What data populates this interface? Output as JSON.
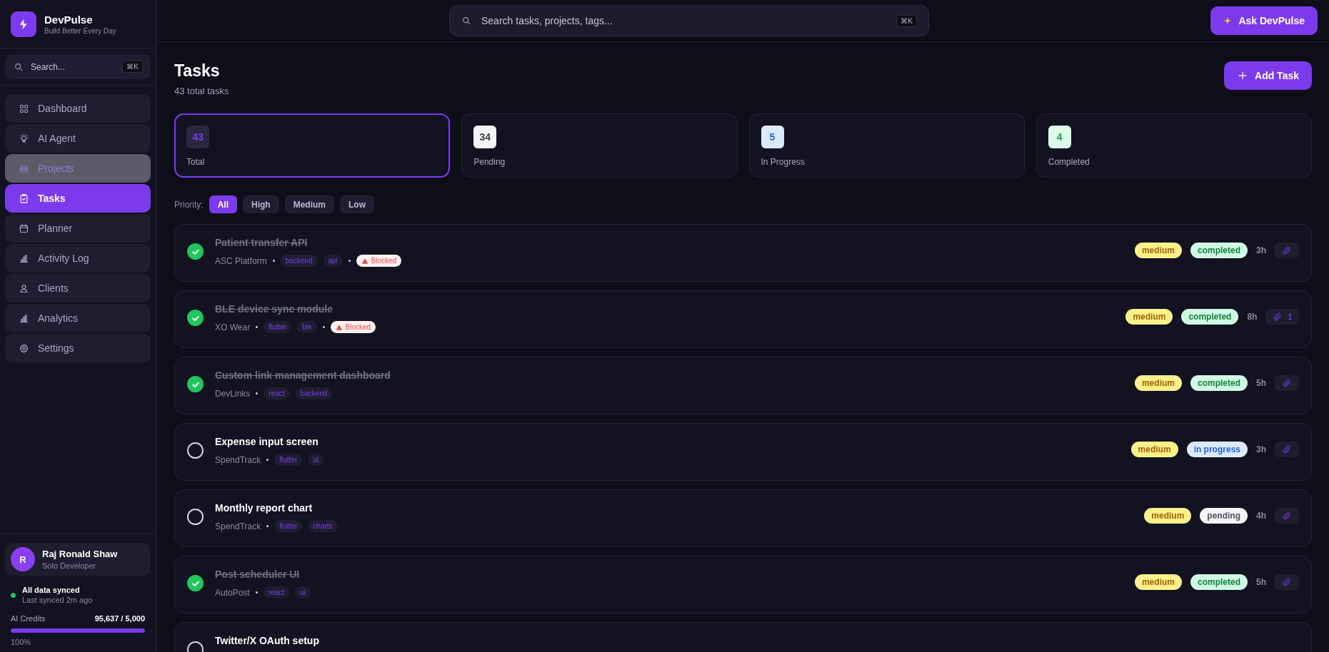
{
  "brand": {
    "name": "DevPulse",
    "tagline": "Build Better Every Day"
  },
  "sidebar": {
    "search": {
      "placeholder": "Search...",
      "shortcut": "⌘K"
    },
    "items": [
      {
        "label": "Dashboard",
        "selected": false,
        "hovered": false
      },
      {
        "label": "AI Agent",
        "selected": false,
        "hovered": false
      },
      {
        "label": "Projects",
        "selected": false,
        "hovered": true
      },
      {
        "label": "Tasks",
        "selected": true,
        "hovered": false
      },
      {
        "label": "Planner",
        "selected": false,
        "hovered": false
      },
      {
        "label": "Activity Log",
        "selected": false,
        "hovered": false
      },
      {
        "label": "Clients",
        "selected": false,
        "hovered": false
      },
      {
        "label": "Analytics",
        "selected": false,
        "hovered": false
      },
      {
        "label": "Settings",
        "selected": false,
        "hovered": false
      }
    ],
    "user": {
      "initial": "R",
      "name": "Raj Ronald Shaw",
      "role": "Solo Developer"
    },
    "sync": {
      "title": "All data synced",
      "detail": "Last synced 2m ago",
      "color": "#22c55e"
    },
    "credits": {
      "label": "AI Credits",
      "reading": "95,637 / 5,000",
      "level": 1,
      "percent": "100%"
    }
  },
  "header": {
    "search": {
      "placeholder": "Search tasks, projects, tags...",
      "shortcut": "⌘K"
    },
    "ask_button": "Ask DevPulse"
  },
  "page": {
    "title": "Tasks",
    "subtitle": "43 total tasks",
    "add_button": "Add Task"
  },
  "stats": [
    {
      "value": "43",
      "label": "Total",
      "kind": "total",
      "selected": true
    },
    {
      "value": "34",
      "label": "Pending",
      "kind": "pending",
      "selected": false
    },
    {
      "value": "5",
      "label": "In Progress",
      "kind": "progress",
      "selected": false
    },
    {
      "value": "4",
      "label": "Completed",
      "kind": "completed",
      "selected": false
    }
  ],
  "priority_filter": {
    "label": "Priority:",
    "options": [
      {
        "label": "All",
        "selected": true
      },
      {
        "label": "High",
        "selected": false
      },
      {
        "label": "Medium",
        "selected": false
      },
      {
        "label": "Low",
        "selected": false
      }
    ]
  },
  "tasks": [
    {
      "title": "Patient transfer API",
      "done": true,
      "project": "ASC Platform",
      "tags": [
        "backend",
        "api"
      ],
      "blocked": "Blocked",
      "priority": "medium",
      "status": "completed",
      "kind": "completed",
      "time": "3h"
    },
    {
      "title": "BLE device sync module",
      "done": true,
      "project": "XO Wear",
      "tags": [
        "flutter",
        "ble"
      ],
      "blocked": "Blocked",
      "priority": "medium",
      "status": "completed",
      "kind": "completed",
      "time": "8h",
      "attachments": "1"
    },
    {
      "title": "Custom link management dashboard",
      "done": true,
      "project": "DevLinks",
      "tags": [
        "react",
        "backend"
      ],
      "priority": "medium",
      "status": "completed",
      "kind": "completed",
      "time": "5h"
    },
    {
      "title": "Expense input screen",
      "done": false,
      "project": "SpendTrack",
      "tags": [
        "flutter",
        "ui"
      ],
      "priority": "medium",
      "status": "in progress",
      "kind": "progress",
      "time": "3h"
    },
    {
      "title": "Monthly report chart",
      "done": false,
      "project": "SpendTrack",
      "tags": [
        "flutter",
        "charts"
      ],
      "priority": "medium",
      "status": "pending",
      "kind": "pending",
      "time": "4h"
    },
    {
      "title": "Post scheduler UI",
      "done": true,
      "project": "AutoPost",
      "tags": [
        "react",
        "ui"
      ],
      "priority": "medium",
      "status": "completed",
      "kind": "completed",
      "time": "5h"
    },
    {
      "title": "Twitter/X OAuth setup",
      "done": false
    }
  ]
}
